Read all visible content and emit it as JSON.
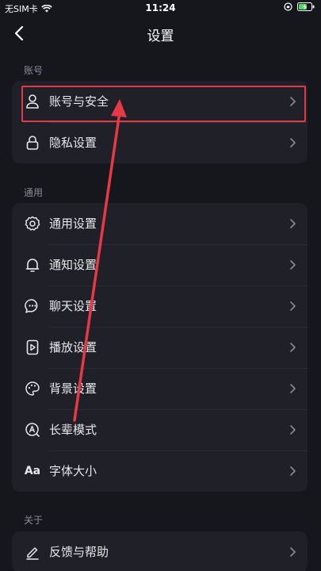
{
  "status_bar": {
    "carrier": "无SIM卡",
    "time": "11:24"
  },
  "nav": {
    "title": "设置",
    "back_icon": "chevron-left-icon"
  },
  "sections": [
    {
      "title": "账号",
      "items": [
        {
          "label": "账号与安全",
          "icon": "person-icon"
        },
        {
          "label": "隐私设置",
          "icon": "lock-icon"
        }
      ]
    },
    {
      "title": "通用",
      "items": [
        {
          "label": "通用设置",
          "icon": "gear-icon"
        },
        {
          "label": "通知设置",
          "icon": "bell-icon"
        },
        {
          "label": "聊天设置",
          "icon": "chat-bubble-icon"
        },
        {
          "label": "播放设置",
          "icon": "play-icon"
        },
        {
          "label": "背景设置",
          "icon": "palette-icon"
        },
        {
          "label": "长辈模式",
          "icon": "elder-mode-icon"
        },
        {
          "label": "字体大小",
          "icon": "font-size-icon",
          "icon_text": "Aa"
        }
      ]
    },
    {
      "title": "关于",
      "items": [
        {
          "label": "反馈与帮助",
          "icon": "pencil-icon"
        }
      ]
    }
  ],
  "colors": {
    "background": "#16171d",
    "card": "#1f2028",
    "annotation": "#e53945"
  }
}
